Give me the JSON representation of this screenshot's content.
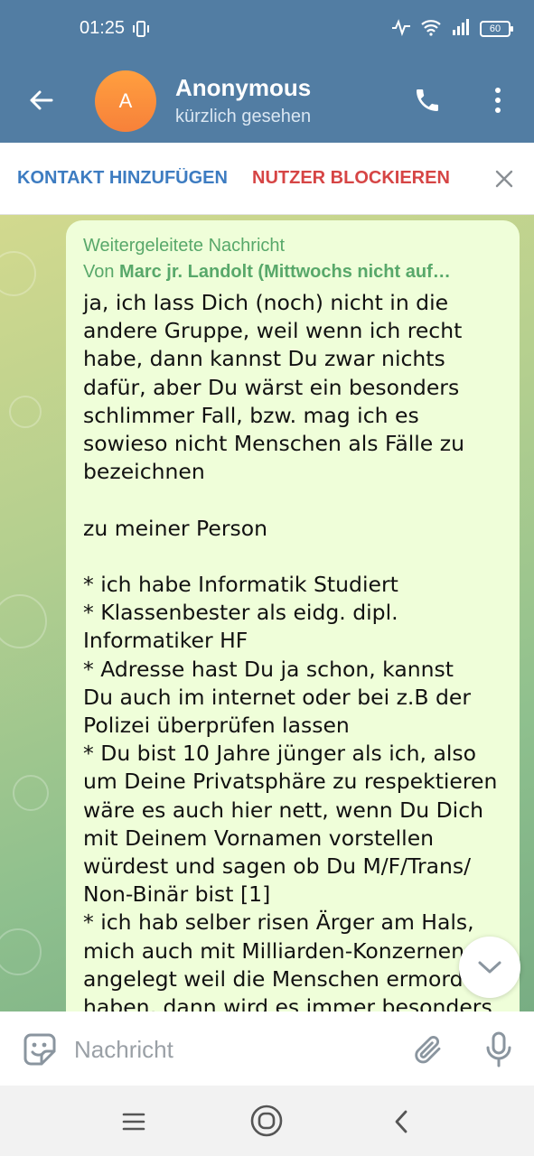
{
  "status_bar": {
    "time": "01:25",
    "battery": "60",
    "icons": [
      "vibrate-icon",
      "activity-icon",
      "wifi-icon",
      "signal-icon",
      "battery-icon"
    ]
  },
  "header": {
    "avatar_letter": "A",
    "title": "Anonymous",
    "subtitle": "kürzlich gesehen",
    "colors": {
      "bar": "#527da3",
      "avatar": "#f7813a"
    }
  },
  "action_bar": {
    "add_contact": "KONTAKT HINZUFÜGEN",
    "block_user": "NUTZER BLOCKIEREN"
  },
  "message": {
    "forwarded_label": "Weitergeleitete Nachricht",
    "from_prefix": "Von ",
    "from_name": "Marc jr. Landolt (Mittwochs nicht auf…",
    "text": "ja, ich lass Dich (noch) nicht in die\nandere Gruppe, weil wenn ich recht\nhabe, dann kannst Du zwar nichts\ndafür, aber Du wärst ein besonders\nschlimmer Fall, bzw. mag ich es\nsowieso nicht Menschen als Fälle zu\nbezeichnen\n\nzu meiner Person\n\n* ich habe Informatik Studiert\n* Klassenbester als eidg. dipl.\nInformatiker HF\n* Adresse hast Du ja schon, kannst\nDu auch im internet oder bei z.B der\nPolizei überprüfen lassen\n* Du bist 10 Jahre jünger als ich, also\num Deine Privatsphäre zu respektieren\nwäre es auch hier nett, wenn Du Dich\nmit Deinem Vornamen vorstellen\nwürdest und sagen ob Du M/F/Trans/\nNon-Binär bist [1]\n* ich hab selber risen Ärger am Hals,\nmich auch mit Milliarden-Konzernen\nangelegt weil die Menschen ermord\nhaben, dann wird es immer besonders"
  },
  "input_bar": {
    "placeholder": "Nachricht"
  }
}
